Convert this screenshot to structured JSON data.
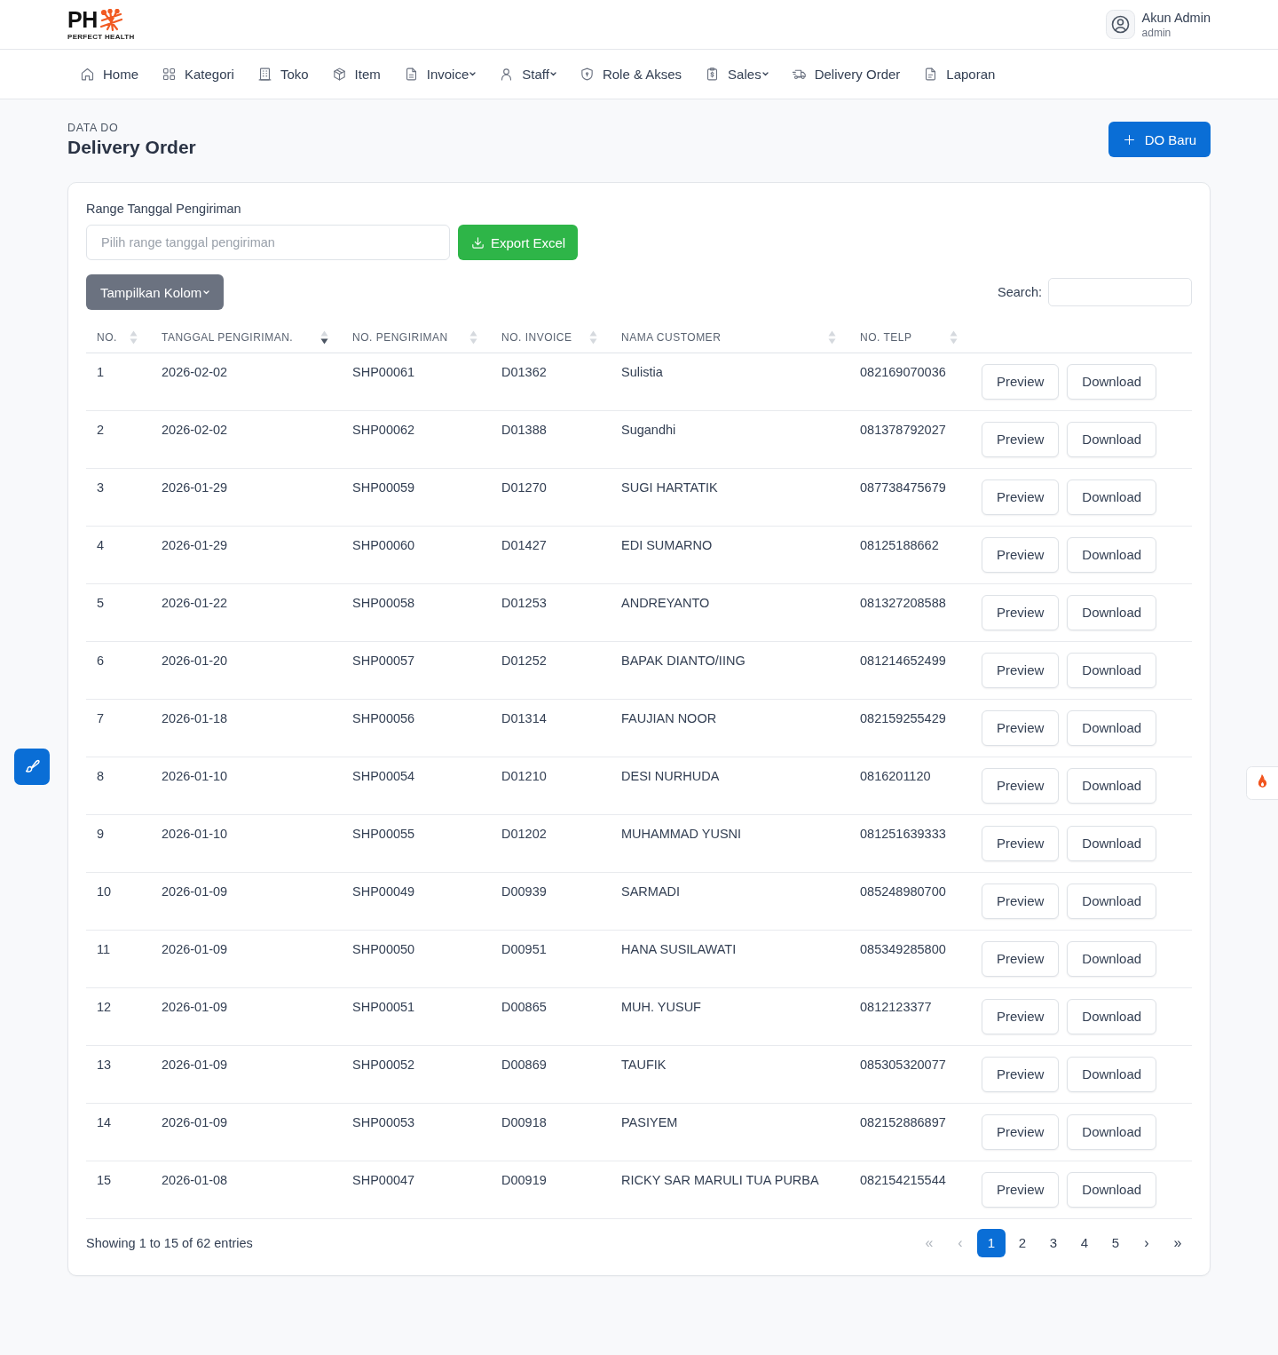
{
  "header": {
    "logo": {
      "text": "PH",
      "tagline": "PERFECT HEALTH"
    },
    "user": {
      "name": "Akun Admin",
      "role": "admin"
    }
  },
  "nav": [
    {
      "label": "Home",
      "dropdown": false
    },
    {
      "label": "Kategori",
      "dropdown": false
    },
    {
      "label": "Toko",
      "dropdown": false
    },
    {
      "label": "Item",
      "dropdown": false
    },
    {
      "label": "Invoice",
      "dropdown": true
    },
    {
      "label": "Staff",
      "dropdown": true
    },
    {
      "label": "Role & Akses",
      "dropdown": false
    },
    {
      "label": "Sales",
      "dropdown": true
    },
    {
      "label": "Delivery Order",
      "dropdown": false
    },
    {
      "label": "Laporan",
      "dropdown": false
    }
  ],
  "page_header": {
    "overline": "DATA DO",
    "title": "Delivery Order",
    "new_button": "DO Baru"
  },
  "filter": {
    "label": "Range Tanggal Pengiriman",
    "date_range": {
      "placeholder": "Pilih range tanggal pengiriman"
    },
    "export_button": "Export Excel"
  },
  "toolbar": {
    "columns_button": "Tampilkan Kolom",
    "search_label": "Search:"
  },
  "table": {
    "columns": [
      {
        "label": "NO.",
        "sorted": false
      },
      {
        "label": "TANGGAL PENGIRIMAN.",
        "sorted": true
      },
      {
        "label": "NO. PENGIRIMAN",
        "sorted": false
      },
      {
        "label": "NO. INVOICE",
        "sorted": false
      },
      {
        "label": "NAMA CUSTOMER",
        "sorted": false
      },
      {
        "label": "NO. TELP",
        "sorted": false
      }
    ],
    "rows": [
      {
        "cells": [
          "1",
          "2026-02-02",
          "SHP00061",
          "D01362",
          "Sulistia",
          "082169070036"
        ],
        "actions": [
          "Preview",
          "Download"
        ]
      },
      {
        "cells": [
          "2",
          "2026-02-02",
          "SHP00062",
          "D01388",
          "Sugandhi",
          "081378792027"
        ],
        "actions": [
          "Preview",
          "Download"
        ]
      },
      {
        "cells": [
          "3",
          "2026-01-29",
          "SHP00059",
          "D01270",
          "SUGI HARTATIK",
          "087738475679"
        ],
        "actions": [
          "Preview",
          "Download"
        ]
      },
      {
        "cells": [
          "4",
          "2026-01-29",
          "SHP00060",
          "D01427",
          "EDI SUMARNO",
          "08125188662"
        ],
        "actions": [
          "Preview",
          "Download"
        ]
      },
      {
        "cells": [
          "5",
          "2026-01-22",
          "SHP00058",
          "D01253",
          "ANDREYANTO",
          "081327208588"
        ],
        "actions": [
          "Preview",
          "Download"
        ]
      },
      {
        "cells": [
          "6",
          "2026-01-20",
          "SHP00057",
          "D01252",
          "BAPAK DIANTO/IING",
          "081214652499"
        ],
        "actions": [
          "Preview",
          "Download"
        ]
      },
      {
        "cells": [
          "7",
          "2026-01-18",
          "SHP00056",
          "D01314",
          "FAUJIAN NOOR",
          "082159255429"
        ],
        "actions": [
          "Preview",
          "Download"
        ]
      },
      {
        "cells": [
          "8",
          "2026-01-10",
          "SHP00054",
          "D01210",
          "DESI NURHUDA",
          "0816201120"
        ],
        "actions": [
          "Preview",
          "Download"
        ]
      },
      {
        "cells": [
          "9",
          "2026-01-10",
          "SHP00055",
          "D01202",
          "MUHAMMAD YUSNI",
          "081251639333"
        ],
        "actions": [
          "Preview",
          "Download"
        ]
      },
      {
        "cells": [
          "10",
          "2026-01-09",
          "SHP00049",
          "D00939",
          "SARMADI",
          "085248980700"
        ],
        "actions": [
          "Preview",
          "Download"
        ]
      },
      {
        "cells": [
          "11",
          "2026-01-09",
          "SHP00050",
          "D00951",
          "HANA SUSILAWATI",
          "085349285800"
        ],
        "actions": [
          "Preview",
          "Download"
        ]
      },
      {
        "cells": [
          "12",
          "2026-01-09",
          "SHP00051",
          "D00865",
          "MUH. YUSUF",
          "0812123377"
        ],
        "actions": [
          "Preview",
          "Download"
        ]
      },
      {
        "cells": [
          "13",
          "2026-01-09",
          "SHP00052",
          "D00869",
          "TAUFIK",
          "085305320077"
        ],
        "actions": [
          "Preview",
          "Download"
        ]
      },
      {
        "cells": [
          "14",
          "2026-01-09",
          "SHP00053",
          "D00918",
          "PASIYEM",
          "082152886897"
        ],
        "actions": [
          "Preview",
          "Download"
        ]
      },
      {
        "cells": [
          "15",
          "2026-01-08",
          "SHP00047",
          "D00919",
          "RICKY SAR MARULI TUA PURBA",
          "082154215544"
        ],
        "actions": [
          "Preview",
          "Download"
        ]
      }
    ]
  },
  "footer": {
    "info": "Showing 1 to 15 of 62 entries",
    "pagination": [
      {
        "kind": "first",
        "label": "«",
        "selected": false,
        "disabled": true
      },
      {
        "kind": "prev",
        "label": "‹",
        "selected": false,
        "disabled": true
      },
      {
        "kind": "page",
        "label": "1",
        "selected": true,
        "disabled": false
      },
      {
        "kind": "page",
        "label": "2",
        "selected": false,
        "disabled": false
      },
      {
        "kind": "page",
        "label": "3",
        "selected": false,
        "disabled": false
      },
      {
        "kind": "page",
        "label": "4",
        "selected": false,
        "disabled": false
      },
      {
        "kind": "page",
        "label": "5",
        "selected": false,
        "disabled": false
      },
      {
        "kind": "next",
        "label": "›",
        "selected": false,
        "disabled": false
      },
      {
        "kind": "last",
        "label": "»",
        "selected": false,
        "disabled": false
      }
    ]
  }
}
